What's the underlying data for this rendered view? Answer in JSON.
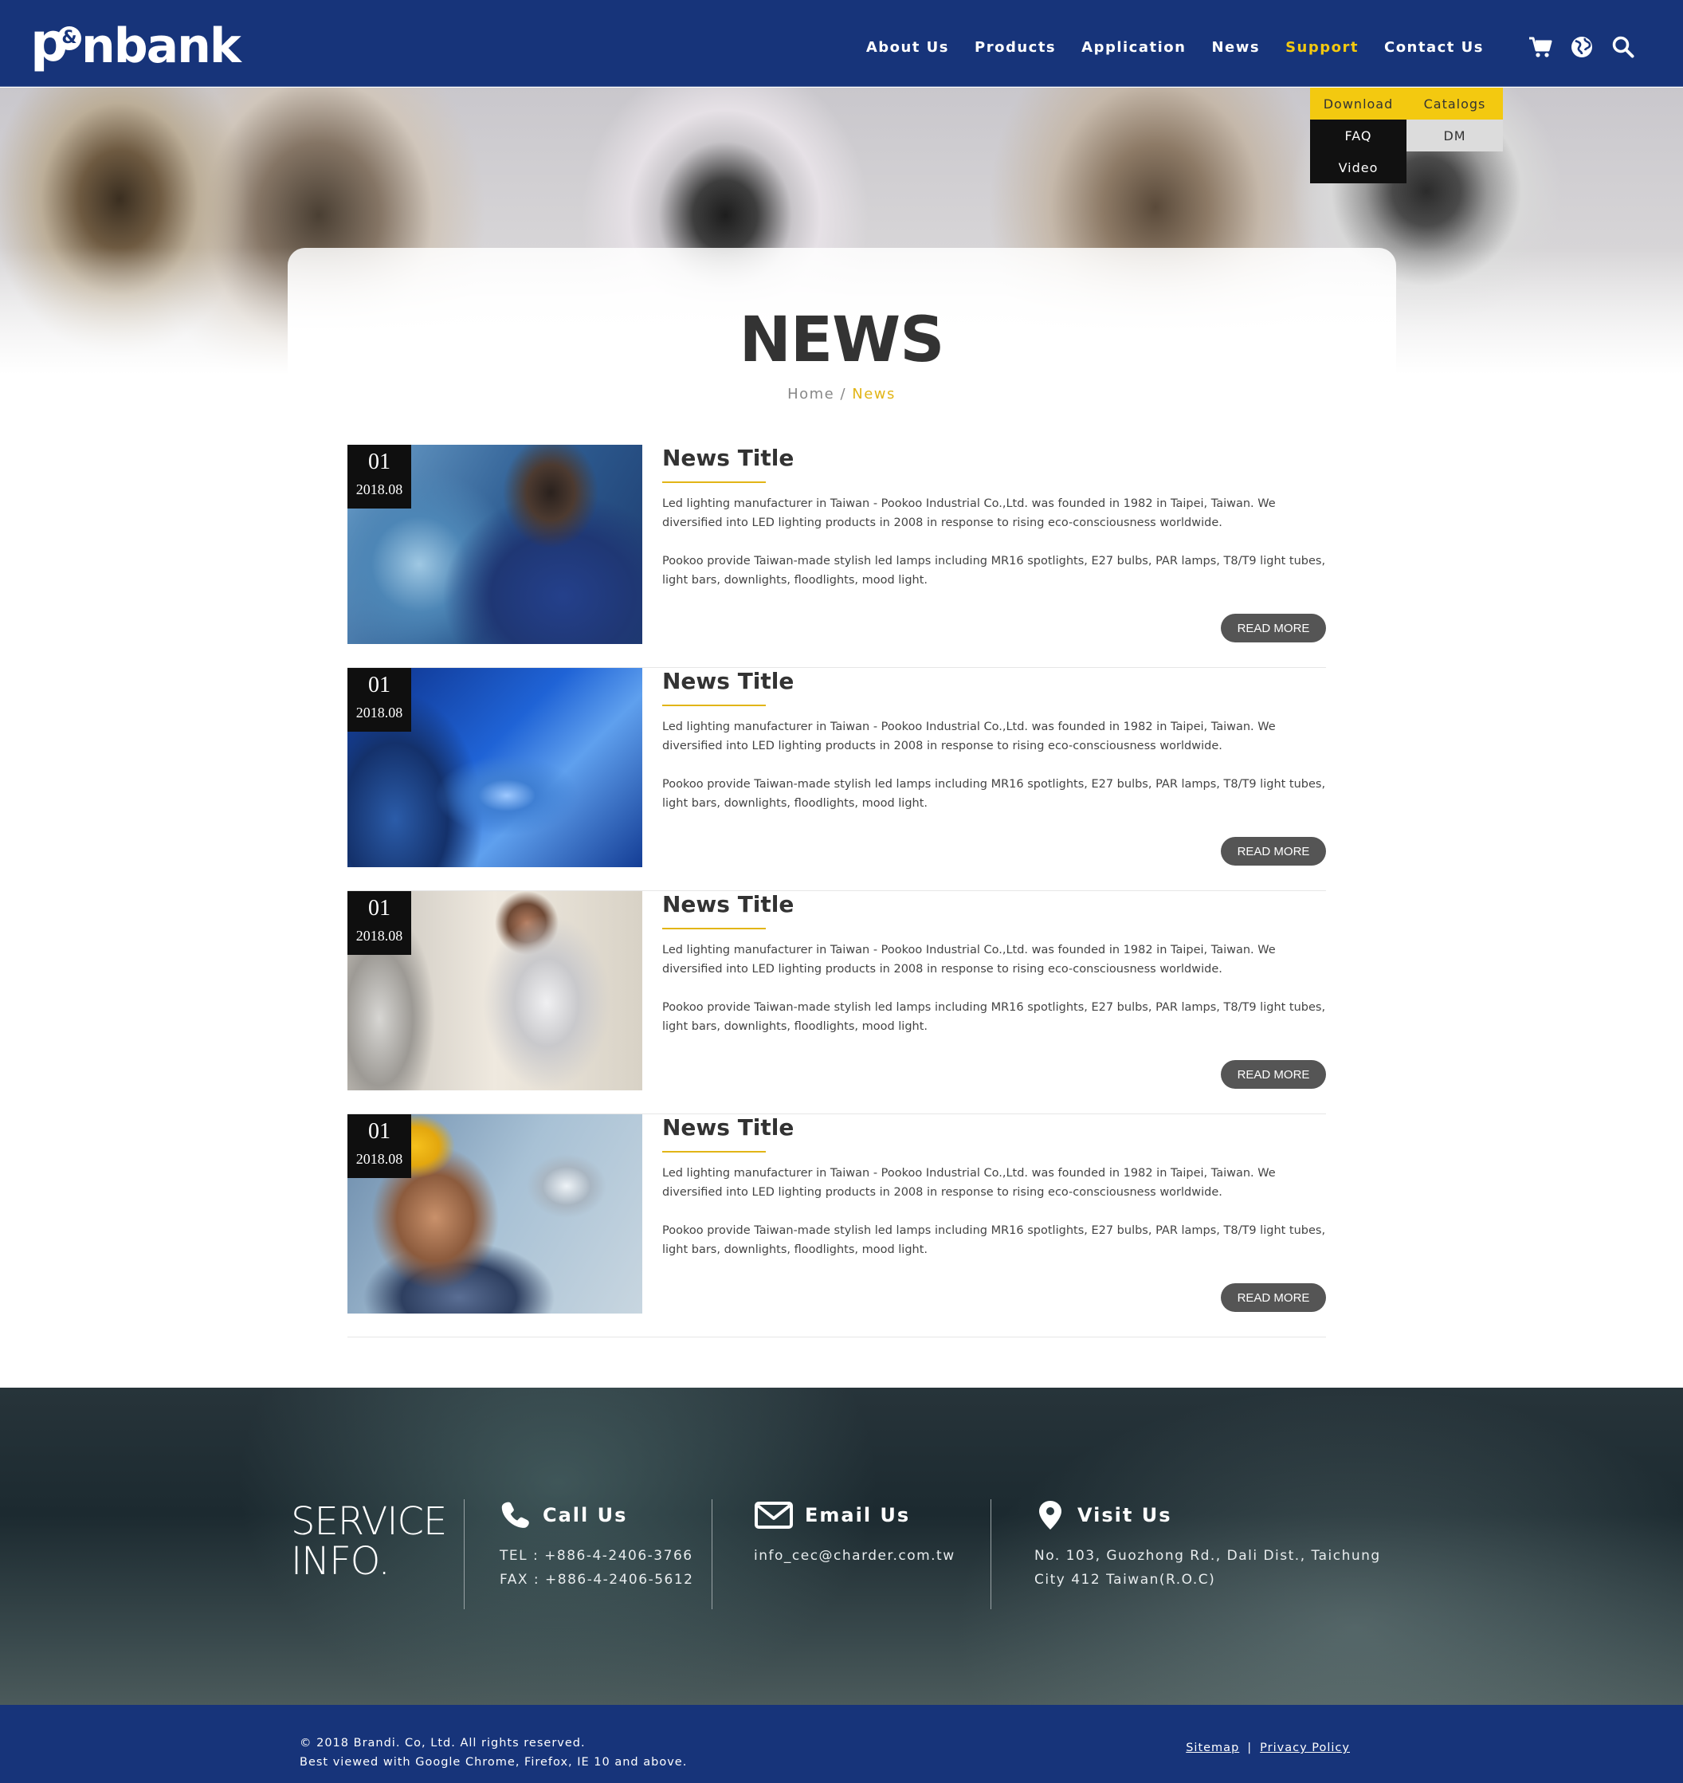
{
  "brand": {
    "logo_mark": "p",
    "logo_amp": "&",
    "logo_word": "nbank"
  },
  "nav": [
    {
      "label": "About Us",
      "active": false
    },
    {
      "label": "Products",
      "active": false
    },
    {
      "label": "Application",
      "active": false
    },
    {
      "label": "News",
      "active": false
    },
    {
      "label": "Support",
      "active": true
    },
    {
      "label": "Contact Us",
      "active": false
    }
  ],
  "header_icons": [
    "cart-icon",
    "globe-icon",
    "search-icon"
  ],
  "support_menu": {
    "download": "Download",
    "catalogs": "Catalogs",
    "faq": "FAQ",
    "dm": "DM",
    "video": "Video"
  },
  "page": {
    "title": "NEWS",
    "breadcrumb_home": "Home",
    "breadcrumb_sep": " / ",
    "breadcrumb_current": "News"
  },
  "news": [
    {
      "day": "01",
      "ym": "2018.08",
      "title": "News Title",
      "p1": "Led lighting manufacturer in Taiwan - Pookoo Industrial Co.,Ltd. was founded in 1982 in Taipei, Taiwan. We diversified into LED lighting products in 2008 in response to rising eco-consciousness worldwide.",
      "p2": "Pookoo provide Taiwan-made stylish led lamps including MR16 spotlights, E27 bulbs, PAR lamps, T8/T9 light tubes, light bars, downlights, floodlights, mood light.",
      "button": "READ MORE"
    },
    {
      "day": "01",
      "ym": "2018.08",
      "title": "News Title",
      "p1": "Led lighting manufacturer in Taiwan - Pookoo Industrial Co.,Ltd. was founded in 1982 in Taipei, Taiwan. We diversified into LED lighting products in 2008 in response to rising eco-consciousness worldwide.",
      "p2": "Pookoo provide Taiwan-made stylish led lamps including MR16 spotlights, E27 bulbs, PAR lamps, T8/T9 light tubes, light bars, downlights, floodlights, mood light.",
      "button": "READ MORE"
    },
    {
      "day": "01",
      "ym": "2018.08",
      "title": "News Title",
      "p1": "Led lighting manufacturer in Taiwan - Pookoo Industrial Co.,Ltd. was founded in 1982 in Taipei, Taiwan. We diversified into LED lighting products in 2008 in response to rising eco-consciousness worldwide.",
      "p2": "Pookoo provide Taiwan-made stylish led lamps including MR16 spotlights, E27 bulbs, PAR lamps, T8/T9 light tubes, light bars, downlights, floodlights, mood light.",
      "button": "READ MORE"
    },
    {
      "day": "01",
      "ym": "2018.08",
      "title": "News Title",
      "p1": "Led lighting manufacturer in Taiwan - Pookoo Industrial Co.,Ltd. was founded in 1982 in Taipei, Taiwan. We diversified into LED lighting products in 2008 in response to rising eco-consciousness worldwide.",
      "p2": "Pookoo provide Taiwan-made stylish led lamps including MR16 spotlights, E27 bulbs, PAR lamps, T8/T9 light tubes, light bars, downlights, floodlights, mood light.",
      "button": "READ MORE"
    }
  ],
  "service": {
    "heading_line1": "SERVICE",
    "heading_line2": "INFO.",
    "call": {
      "label": "Call Us",
      "tel": "TEL : +886-4-2406-3766",
      "fax": "FAX : +886-4-2406-5612"
    },
    "email": {
      "label": "Email Us",
      "address": "info_cec@charder.com.tw"
    },
    "visit": {
      "label": "Visit Us",
      "line1": "No. 103, Guozhong Rd., Dali Dist., Taichung",
      "line2": "City 412 Taiwan(R.O.C)"
    }
  },
  "footer": {
    "copyright": "© 2018 Brandi. Co, Ltd. All rights reserved.",
    "browsers": "Best viewed with Google Chrome, Firefox, IE 10 and above.",
    "sitemap": "Sitemap",
    "separator": "|",
    "privacy": "Privacy Policy"
  },
  "colors": {
    "navy": "#17347a",
    "accent": "#f3c910",
    "gold_line": "#e2b517",
    "button": "#555555"
  }
}
